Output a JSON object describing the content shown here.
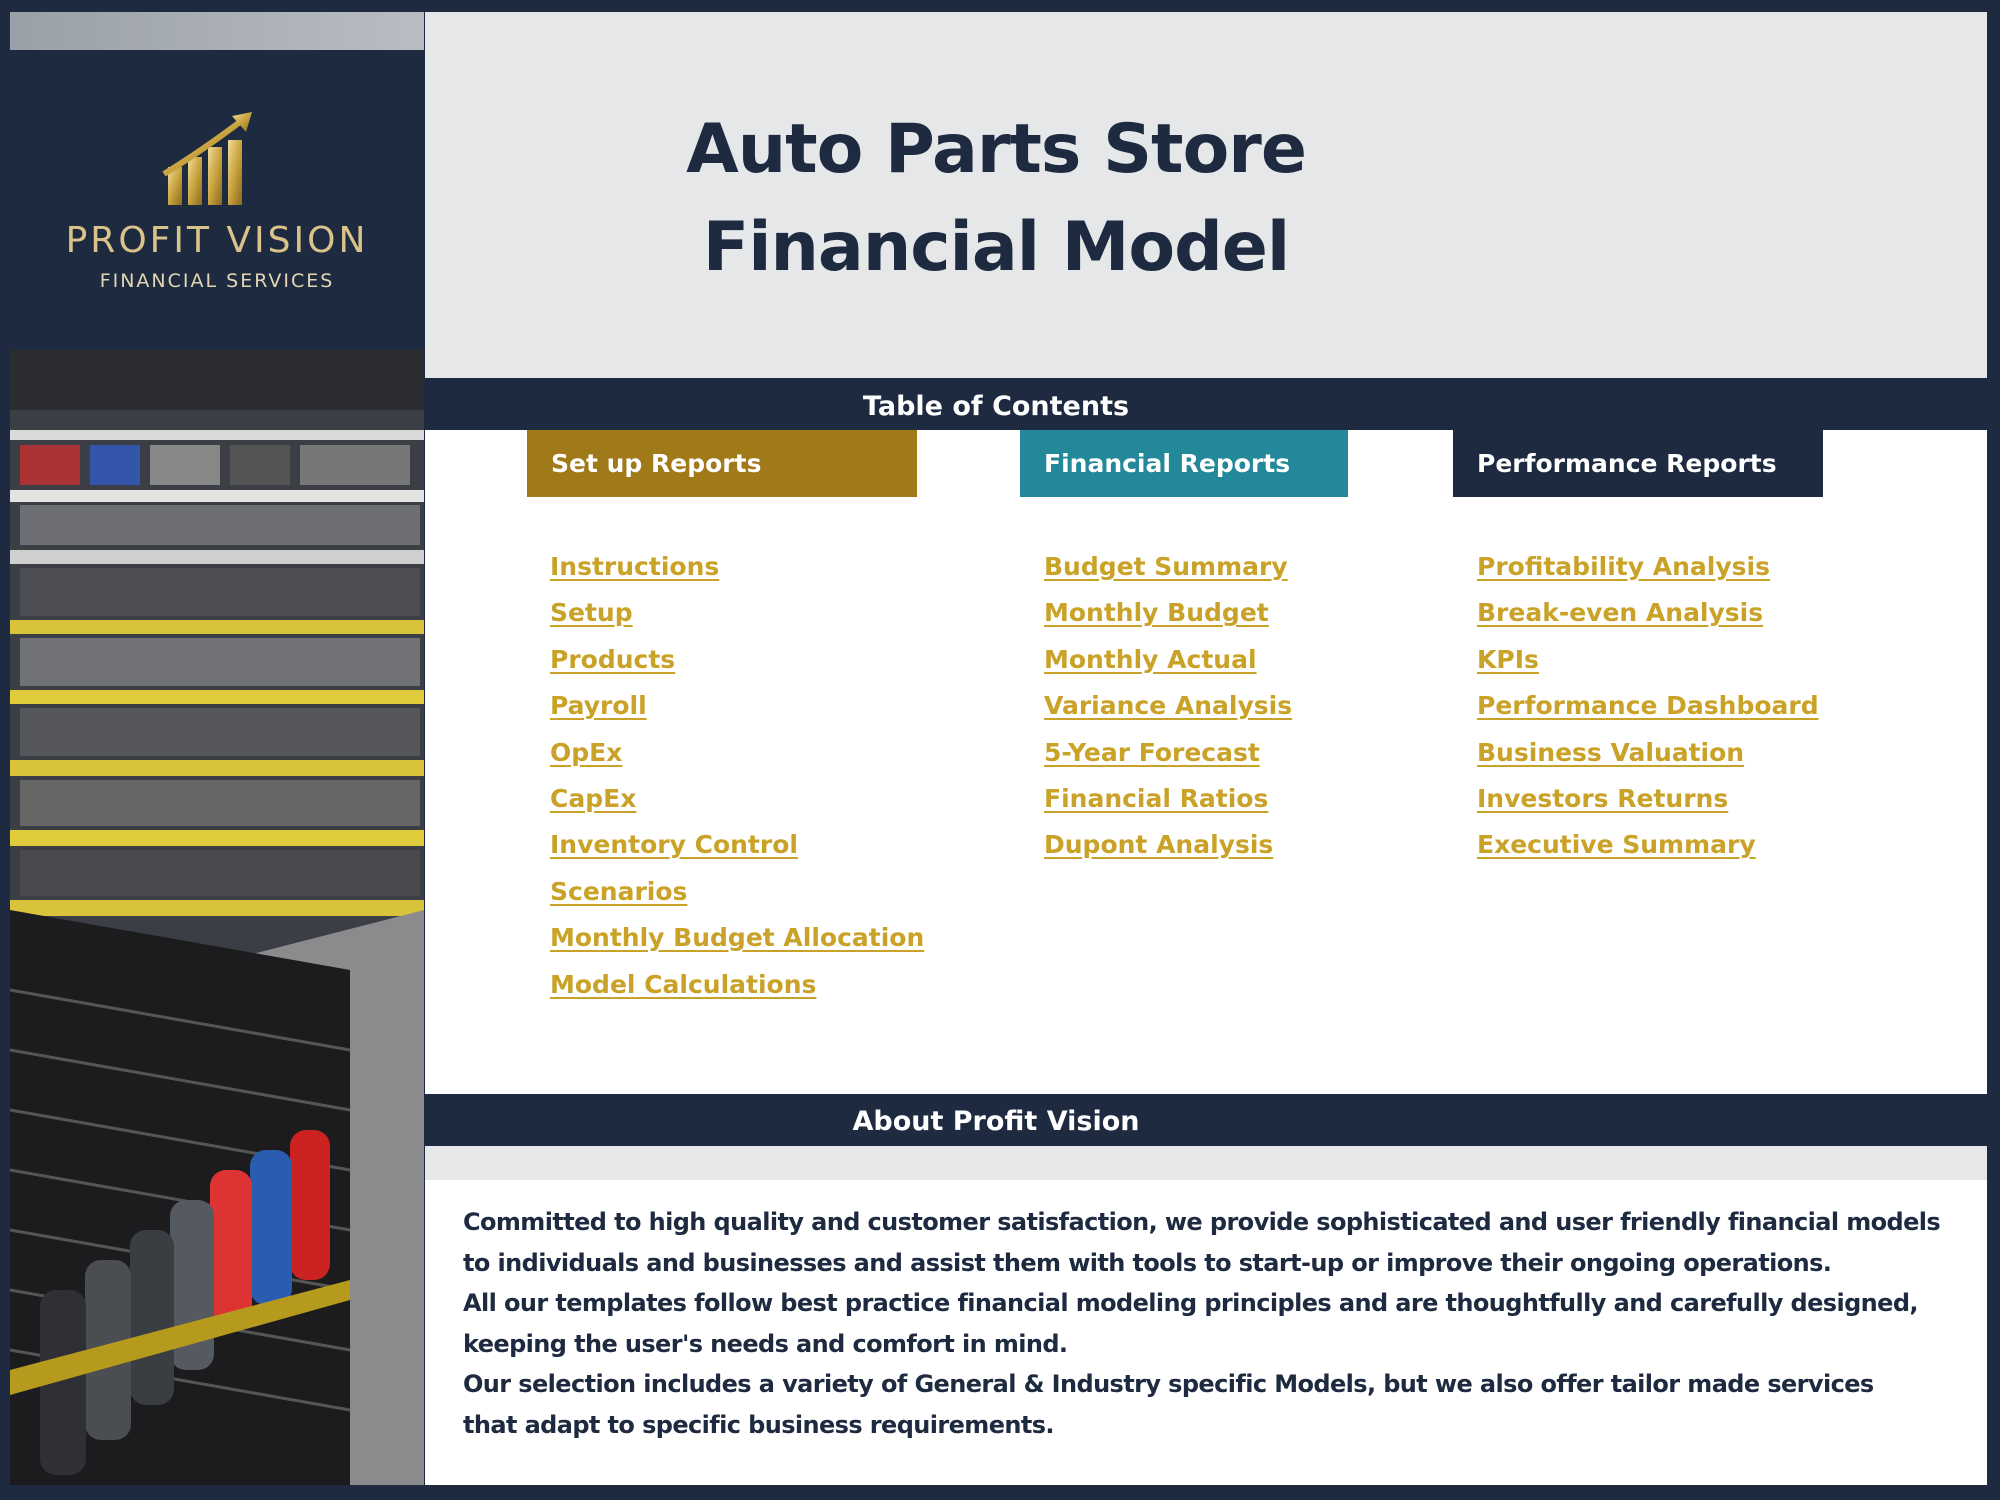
{
  "brand": {
    "name": "PROFIT VISION",
    "subtitle": "FINANCIAL SERVICES",
    "logo_icon": "bar-chart-arrow-icon",
    "gold": "#c9a227"
  },
  "title": {
    "line1": "Auto Parts Store",
    "line2": "Financial Model"
  },
  "toc": {
    "heading": "Table of Contents",
    "columns": [
      {
        "label": "Set up Reports",
        "color": "#a07918",
        "links": [
          "Instructions",
          "Setup",
          "Products",
          "Payroll",
          "OpEx",
          "CapEx",
          "Inventory Control",
          "Scenarios",
          "Monthly Budget Allocation",
          "Model Calculations"
        ]
      },
      {
        "label": "Financial Reports",
        "color": "#23889a",
        "links": [
          "Budget Summary",
          "Monthly Budget",
          "Monthly Actual",
          "Variance Analysis",
          "5-Year Forecast",
          "Financial Ratios",
          "Dupont Analysis"
        ]
      },
      {
        "label": "Performance Reports",
        "color": "#1d2a40",
        "links": [
          "Profitability Analysis",
          "Break-even Analysis",
          "KPIs",
          "Performance Dashboard",
          "Business Valuation",
          "Investors Returns",
          "Executive Summary"
        ]
      }
    ]
  },
  "about": {
    "heading": "About Profit Vision",
    "lines": [
      "Committed to high quality and customer satisfaction, we provide sophisticated and user friendly financial models",
      "to individuals and businesses and assist them  with tools to start-up or improve their ongoing operations.",
      "All our templates follow best practice financial modeling principles and are thoughtfully and carefully designed,",
      "keeping the user's needs and comfort in mind.",
      "Our selection includes a variety of General & Industry specific Models, but we also offer tailor made services",
      "that adapt to specific business requirements."
    ]
  },
  "colors": {
    "navy": "#1d2a40",
    "light_gray": "#e6e7e9",
    "link_gold": "#c9a227"
  }
}
